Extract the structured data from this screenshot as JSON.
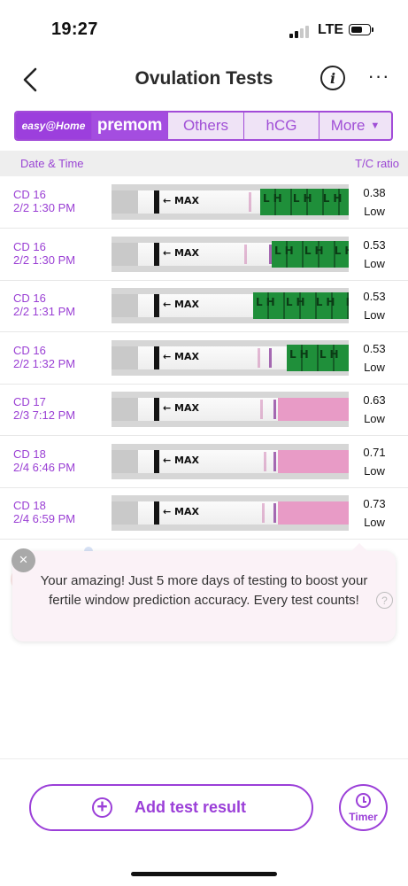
{
  "status": {
    "time": "19:27",
    "network": "LTE"
  },
  "header": {
    "title": "Ovulation Tests",
    "info_glyph": "i",
    "more_glyph": "···"
  },
  "brand_tabs": [
    {
      "label": "easy@Home",
      "selected": false
    },
    {
      "label": "premom",
      "selected": true
    },
    {
      "label": "Others",
      "selected": false
    },
    {
      "label": "hCG",
      "selected": false
    },
    {
      "label": "More",
      "selected": false
    }
  ],
  "columns": {
    "left": "Date & Time",
    "right": "T/C ratio"
  },
  "tests": [
    {
      "cycle_day": "CD 16",
      "datetime": "2/2 1:30 PM",
      "ratio": "0.38",
      "level": "Low",
      "strip": "green"
    },
    {
      "cycle_day": "CD 16",
      "datetime": "2/2 1:30 PM",
      "ratio": "0.53",
      "level": "Low",
      "strip": "green"
    },
    {
      "cycle_day": "CD 16",
      "datetime": "2/2 1:31 PM",
      "ratio": "0.53",
      "level": "Low",
      "strip": "green"
    },
    {
      "cycle_day": "CD 16",
      "datetime": "2/2 1:32 PM",
      "ratio": "0.53",
      "level": "Low",
      "strip": "green"
    },
    {
      "cycle_day": "CD 17",
      "datetime": "2/3 7:12 PM",
      "ratio": "0.63",
      "level": "Low",
      "strip": "pink"
    },
    {
      "cycle_day": "CD 18",
      "datetime": "2/4 6:46 PM",
      "ratio": "0.71",
      "level": "Low",
      "strip": "pink"
    },
    {
      "cycle_day": "CD 18",
      "datetime": "2/4 6:59 PM",
      "ratio": "0.73",
      "level": "Low",
      "strip": "pink"
    }
  ],
  "strip_text": {
    "max": "← MAX",
    "lh": "LH LH LH LH LH"
  },
  "tooltip": {
    "message": "Your amazing! Just 5 more days of testing to boost your fertile window prediction accuracy. Every test counts!",
    "close_glyph": "×",
    "help_glyph": "?"
  },
  "actions": {
    "add_label": "Add test result",
    "timer_label": "Timer"
  },
  "colors": {
    "accent": "#9b3fd8",
    "strip_green": "#1f8f3a",
    "strip_pink": "#e89bc6"
  }
}
